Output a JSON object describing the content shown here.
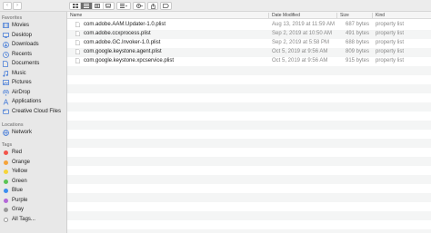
{
  "sidebar": {
    "favorites_title": "Favorites",
    "favorites": [
      {
        "label": "Movies",
        "icon": "movies-icon"
      },
      {
        "label": "Desktop",
        "icon": "desktop-icon"
      },
      {
        "label": "Downloads",
        "icon": "downloads-icon"
      },
      {
        "label": "Recents",
        "icon": "recents-icon"
      },
      {
        "label": "Documents",
        "icon": "documents-icon"
      },
      {
        "label": "Music",
        "icon": "music-icon"
      },
      {
        "label": "Pictures",
        "icon": "pictures-icon"
      },
      {
        "label": "AirDrop",
        "icon": "airdrop-icon"
      },
      {
        "label": "Applications",
        "icon": "applications-icon"
      },
      {
        "label": "Creative Cloud Files",
        "icon": "creative-cloud-icon"
      }
    ],
    "locations_title": "Locations",
    "locations": [
      {
        "label": "Network",
        "icon": "network-icon"
      }
    ],
    "tags_title": "Tags",
    "tags": [
      {
        "label": "Red",
        "color": "#f2544b"
      },
      {
        "label": "Orange",
        "color": "#f5a33a"
      },
      {
        "label": "Yellow",
        "color": "#f6d43a"
      },
      {
        "label": "Green",
        "color": "#5ac454"
      },
      {
        "label": "Blue",
        "color": "#3b8ef0"
      },
      {
        "label": "Purple",
        "color": "#b467d8"
      },
      {
        "label": "Gray",
        "color": "#9a9a9a"
      }
    ],
    "all_tags": "All Tags..."
  },
  "columns": {
    "name": "Name",
    "date": "Date Modified",
    "size": "Size",
    "kind": "Kind"
  },
  "files": [
    {
      "name": "com.adobe.AAM.Updater-1.0.plist",
      "date": "Aug 13, 2019 at 11:59 AM",
      "size": "687 bytes",
      "kind": "property list"
    },
    {
      "name": "com.adobe.ccxprocess.plist",
      "date": "Sep 2, 2019 at 10:50 AM",
      "size": "491 bytes",
      "kind": "property list"
    },
    {
      "name": "com.adobe.GC.Invoker-1.0.plist",
      "date": "Sep 2, 2019 at 5:58 PM",
      "size": "688 bytes",
      "kind": "property list"
    },
    {
      "name": "com.google.keystone.agent.plist",
      "date": "Oct 5, 2019 at 9:56 AM",
      "size": "809 bytes",
      "kind": "property list"
    },
    {
      "name": "com.google.keystone.xpcservice.plist",
      "date": "Oct 5, 2019 at 9:56 AM",
      "size": "915 bytes",
      "kind": "property list"
    }
  ]
}
